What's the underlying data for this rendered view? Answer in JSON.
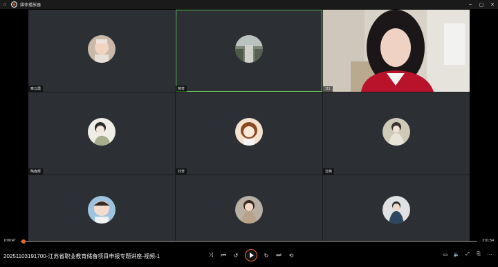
{
  "app": {
    "title": "媒体播放器"
  },
  "participants": [
    {
      "name": "章云霞"
    },
    {
      "name": "黄奇"
    },
    {
      "name": "111"
    },
    {
      "name": "陶春辉"
    },
    {
      "name": "刘芳"
    },
    {
      "name": "沈燕"
    },
    {
      "name": ""
    },
    {
      "name": ""
    },
    {
      "name": ""
    }
  ],
  "playback": {
    "current_time": "0:00:47",
    "total_time": "2:01:54",
    "progress": 0.0064
  },
  "video": {
    "title": "20251103191700-江苏省职业教育储备项目申报专题讲座-视频-1"
  },
  "colors": {
    "accent": "#e8672c",
    "active_speaker": "#6bd26b"
  },
  "icons": {
    "titlebar": [
      "home-icon",
      "app-logo-icon"
    ],
    "window": [
      "minimize-icon",
      "maximize-icon",
      "close-icon"
    ],
    "controls": [
      "shuffle-icon",
      "previous-icon",
      "rewind-10-icon",
      "play-icon",
      "forward-30-icon",
      "next-icon",
      "repeat-icon"
    ],
    "right": [
      "miniplayer-icon",
      "volume-icon",
      "fullscreen-icon",
      "cast-icon",
      "more-icon"
    ]
  }
}
